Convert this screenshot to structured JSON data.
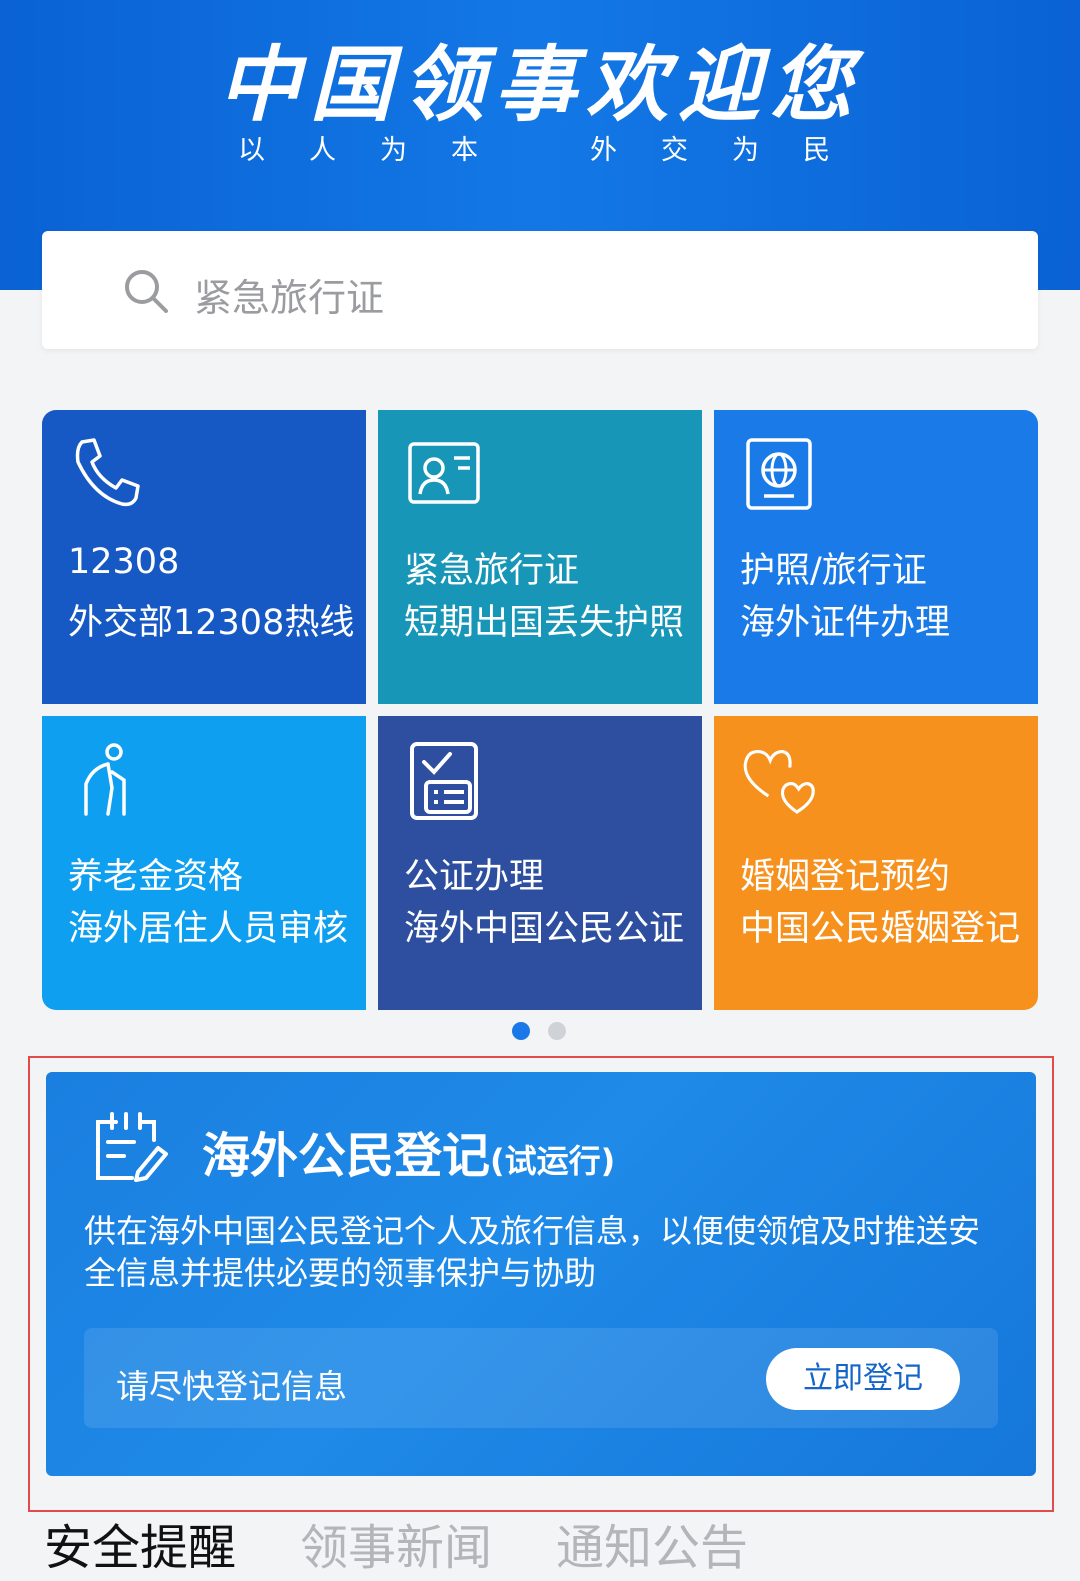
{
  "header": {
    "title": "中国领事欢迎您",
    "slogan_left": "以人为本",
    "slogan_right": "外交为民"
  },
  "search": {
    "placeholder": "紧急旅行证",
    "icon": "search-icon"
  },
  "services": [
    {
      "line1": "12308",
      "line2": "外交部12308热线",
      "color": "#1658c4",
      "icon": "phone-icon"
    },
    {
      "line1": "紧急旅行证",
      "line2": "短期出国丢失护照",
      "color": "#1896b8",
      "icon": "id-card-icon"
    },
    {
      "line1": "护照/旅行证",
      "line2": "海外证件办理",
      "color": "#1a7ae8",
      "icon": "passport-icon"
    },
    {
      "line1": "养老金资格",
      "line2": "海外居住人员审核",
      "color": "#0e9ff0",
      "icon": "elderly-person-icon"
    },
    {
      "line1": "公证办理",
      "line2": "海外中国公民公证",
      "color": "#2e4f9f",
      "icon": "document-check-icon"
    },
    {
      "line1": "婚姻登记预约",
      "line2": "中国公民婚姻登记",
      "color": "#f6911e",
      "icon": "hearts-icon"
    }
  ],
  "pagination": {
    "current": 1,
    "total": 2
  },
  "registration_card": {
    "title": "海外公民登记",
    "title_suffix": "(试运行)",
    "description": "供在海外中国公民登记个人及旅行信息，以便使领馆及时推送安全信息并提供必要的领事保护与协助",
    "prompt": "请尽快登记信息",
    "button_label": "立即登记",
    "icon": "register-form-icon"
  },
  "tabs": [
    {
      "label": "安全提醒",
      "active": true
    },
    {
      "label": "领事新闻",
      "active": false
    },
    {
      "label": "通知公告",
      "active": false
    }
  ],
  "colors": {
    "header_blue": "#0a62d4",
    "card_blue": "#1a7fe0",
    "highlight_red": "#e14b4b",
    "button_text": "#1565c8"
  }
}
